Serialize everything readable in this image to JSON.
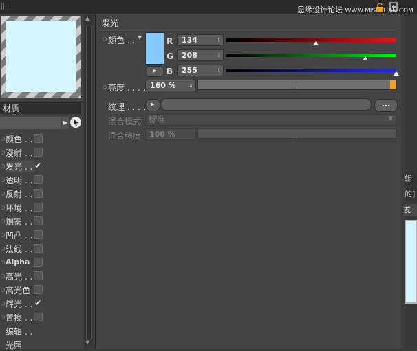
{
  "watermark": {
    "text": "思缘设计论坛",
    "url": "WWW.MISSYUAN.COM"
  },
  "colors": {
    "preview": "#d6f6ff",
    "swatch": "#86c9ff",
    "red": "#e01818",
    "green": "#20e020",
    "blue": "#2030e0",
    "accent": "#f0a020"
  },
  "left": {
    "material_label": "材质",
    "channels": [
      {
        "label": "颜色 . .",
        "checked": false
      },
      {
        "label": "漫射 . .",
        "checked": false
      },
      {
        "label": "发光 . .",
        "checked": true,
        "selected": true
      },
      {
        "label": "透明 . .",
        "checked": false
      },
      {
        "label": "反射 . .",
        "checked": false
      },
      {
        "label": "环境 . .",
        "checked": false
      },
      {
        "label": "烟雾 . .",
        "checked": false
      },
      {
        "label": "凹凸 . .",
        "checked": false
      },
      {
        "label": "法线 . .",
        "checked": false
      },
      {
        "label": "Alpha",
        "checked": false
      },
      {
        "label": "高光 . .",
        "checked": false
      },
      {
        "label": "高光色",
        "checked": false
      },
      {
        "label": "辉光 . .",
        "checked": true
      },
      {
        "label": "置换 . .",
        "checked": false
      },
      {
        "label": "编辑 . .",
        "checked": null
      },
      {
        "label": "光照",
        "checked": null
      }
    ]
  },
  "main": {
    "section_title": "发光",
    "color_label": "颜色 . .",
    "r": {
      "letter": "R",
      "value": "134",
      "fraction": 0.525
    },
    "g": {
      "letter": "G",
      "value": "208",
      "fraction": 0.816
    },
    "b": {
      "letter": "B",
      "value": "255",
      "fraction": 1.0
    },
    "brightness_label": "亮度 . . . .",
    "brightness_value": "160 %",
    "texture_label": "纹理 . . . .",
    "texture_more": "...",
    "blend_mode_label": "混合模式",
    "blend_mode_value": "标准",
    "blend_strength_label": "混合强度",
    "blend_strength_value": "100 %"
  },
  "right": {
    "tab_a": "辑",
    "tab_b": "的]",
    "tab_c": "发光"
  }
}
